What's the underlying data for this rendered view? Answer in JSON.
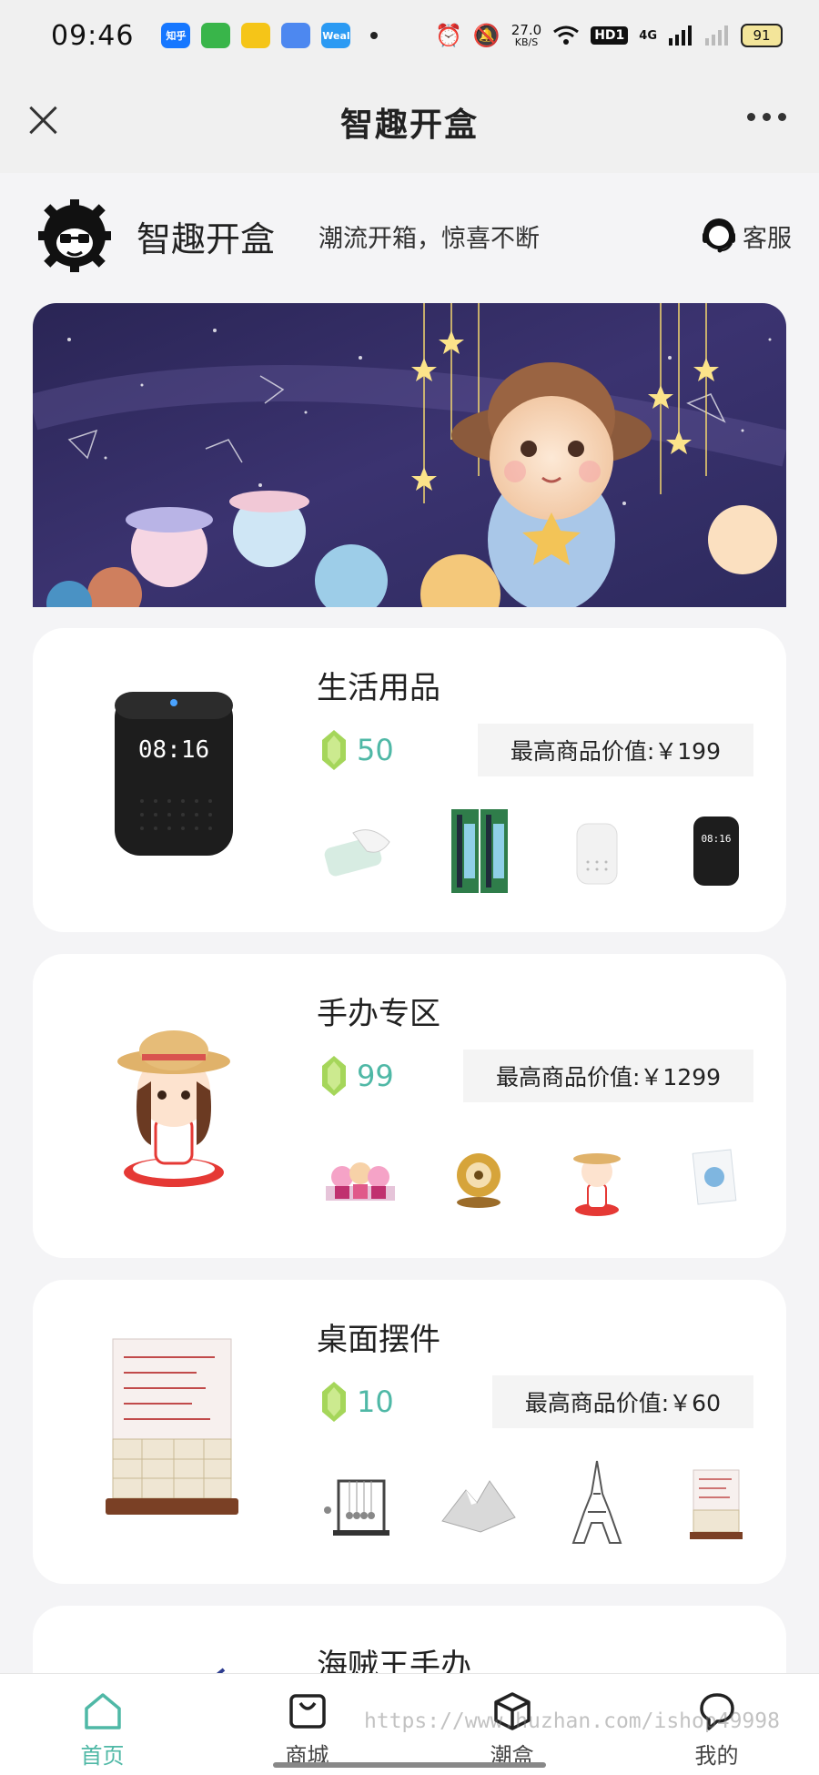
{
  "status_bar": {
    "time": "09:46",
    "apps": [
      "知乎",
      "",
      "",
      "",
      "Weal"
    ],
    "speed": "27.0",
    "speed_unit": "KB/S",
    "hd": "HD1",
    "network": "4G",
    "battery": "91"
  },
  "nav": {
    "title": "智趣开盒"
  },
  "brand": {
    "name": "智趣开盒",
    "slogan": "潮流开箱，惊喜不断",
    "customer_service": "客服"
  },
  "categories": [
    {
      "title": "生活用品",
      "price": "50",
      "max_value": "最高商品价值:￥199"
    },
    {
      "title": "手办专区",
      "price": "99",
      "max_value": "最高商品价值:￥1299"
    },
    {
      "title": "桌面摆件",
      "price": "10",
      "max_value": "最高商品价值:￥60"
    },
    {
      "title": "海贼王手办"
    }
  ],
  "tabs": [
    {
      "label": "首页",
      "icon": "home-icon",
      "active": true
    },
    {
      "label": "商城",
      "icon": "shopping-bag-icon",
      "active": false
    },
    {
      "label": "潮盒",
      "icon": "box-icon",
      "active": false
    },
    {
      "label": "我的",
      "icon": "profile-icon",
      "active": false
    }
  ],
  "watermark": "https://www.huzhan.com/ishop49998",
  "colors": {
    "accent": "#4fb8a6",
    "gem": "#9bd04a",
    "banner_bg": "#2b2a5a"
  }
}
